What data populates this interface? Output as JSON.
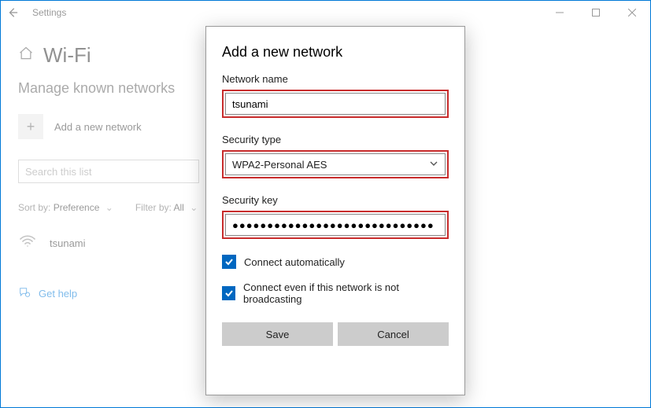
{
  "window": {
    "title": "Settings"
  },
  "page": {
    "heading": "Wi-Fi",
    "subheading": "Manage known networks",
    "add_label": "Add a new network",
    "search_placeholder": "Search this list",
    "sort_label": "Sort by:",
    "sort_value": "Preference",
    "filter_label": "Filter by:",
    "filter_value": "All",
    "network_name": "tsunami",
    "help_label": "Get help"
  },
  "dialog": {
    "title": "Add a new network",
    "network_name_label": "Network name",
    "network_name_value": "tsunami",
    "security_type_label": "Security type",
    "security_type_value": "WPA2-Personal AES",
    "security_key_label": "Security key",
    "security_key_value": "●●●●●●●●●●●●●●●●●●●●●●●●●●●●●",
    "connect_auto_label": "Connect automatically",
    "connect_auto_checked": true,
    "connect_hidden_label": "Connect even if this network is not broadcasting",
    "connect_hidden_checked": true,
    "save_label": "Save",
    "cancel_label": "Cancel"
  }
}
